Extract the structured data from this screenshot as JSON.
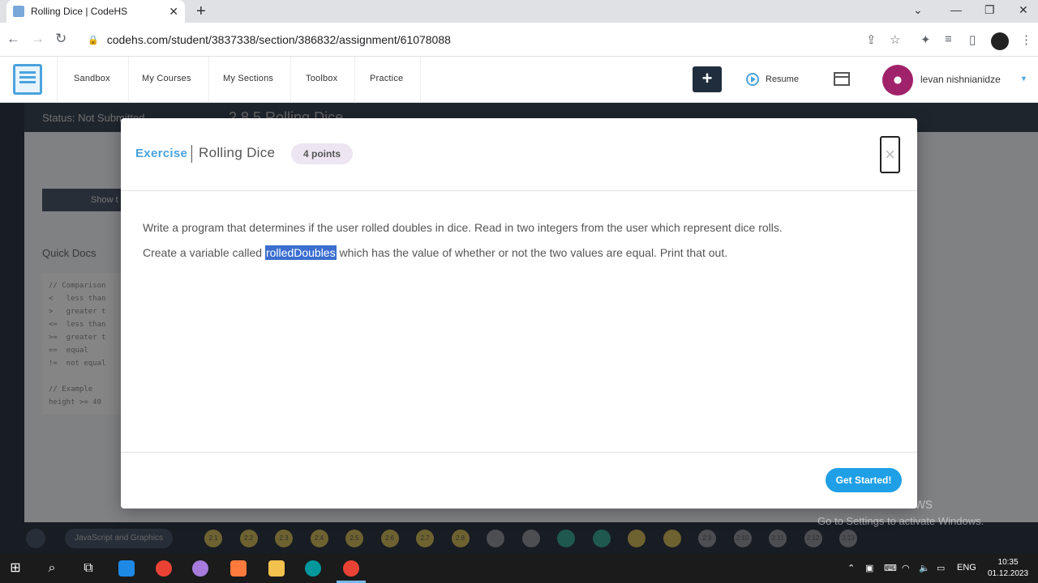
{
  "browser": {
    "tab_title": "Rolling Dice | CodeHS",
    "tab_close": "✕",
    "new_tab": "+",
    "url": "codehs.com/student/3837338/section/386832/assignment/61078088"
  },
  "header": {
    "nav": [
      "Sandbox",
      "My Courses",
      "My Sections",
      "Toolbox",
      "Practice"
    ],
    "plus": "+",
    "resume": "Resume",
    "username": "levan nishnianidze"
  },
  "background": {
    "status": "Status: Not Submitted",
    "title": "2.8.5 Rolling Dice",
    "show_button": "Show t",
    "quick_docs": "Quick Docs",
    "code_lines": [
      "// Comparison",
      "<   less than",
      ">   greater t",
      "<=  less than",
      ">=  greater t",
      "==  equal",
      "!=  not equal",
      "",
      "// Example",
      "height >= 40"
    ],
    "breadcrumb": "JavaScript and Graphics",
    "dots": [
      "2.1",
      "2.2",
      "2.3",
      "2.4",
      "2.5",
      "2.6",
      "2.7",
      "2.8",
      "",
      "",
      "",
      "",
      "",
      "",
      "2.9",
      "2.10",
      "2.11",
      "2.12",
      "2.13"
    ]
  },
  "modal": {
    "kind": "Exercise",
    "title": "Rolling Dice",
    "points": "4 points",
    "close": "×",
    "line1": "Write a program that determines if the user rolled doubles in dice. Read in two integers from the user which represent dice rolls.",
    "line2_before": "Create a variable called ",
    "line2_highlight": "rolledDoubles",
    "line2_after": " which has the value of whether or not the two values are equal. Print that out.",
    "get_started": "Get Started!"
  },
  "watermark": {
    "line1": "Activate Windows",
    "line2": "Go to Settings to activate Windows."
  },
  "taskbar": {
    "language": "ENG",
    "time": "10:35",
    "date": "01.12.2023"
  },
  "colors": {
    "accent": "#4aa3df",
    "primary_button": "#1f9fe6",
    "highlight": "#3b6ed0",
    "points_badge": "#ede6f2"
  }
}
